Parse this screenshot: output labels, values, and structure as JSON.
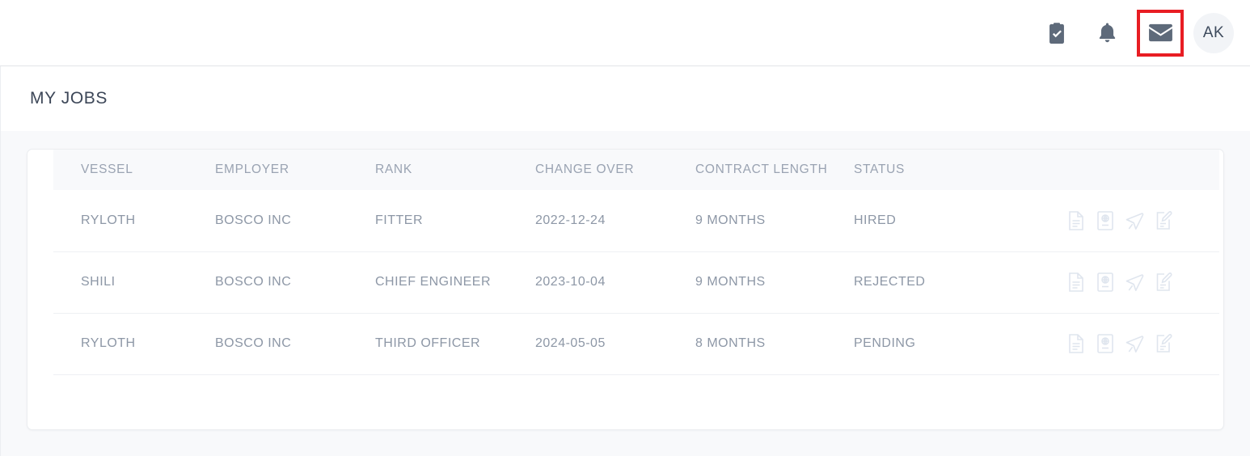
{
  "topbar": {
    "icons": [
      {
        "name": "clipboard-check-icon",
        "label": "Tasks"
      },
      {
        "name": "bell-icon",
        "label": "Notifications"
      },
      {
        "name": "mail-icon",
        "label": "Messages"
      }
    ],
    "mail_highlighted": true,
    "highlight_color": "#e81d23",
    "avatar_initials": "AK"
  },
  "page": {
    "title": "MY JOBS"
  },
  "table": {
    "columns": [
      "VESSEL",
      "EMPLOYER",
      "RANK",
      "CHANGE OVER",
      "CONTRACT LENGTH",
      "STATUS"
    ],
    "row_action_icons": [
      "document-icon",
      "passport-icon",
      "airplane-icon",
      "document-edit-icon"
    ],
    "rows": [
      {
        "vessel": "RYLOTH",
        "employer": "BOSCO INC",
        "rank": "FITTER",
        "change_over": "2022-12-24",
        "contract_length": "9 MONTHS",
        "status": "HIRED"
      },
      {
        "vessel": "SHILI",
        "employer": "BOSCO INC",
        "rank": "CHIEF ENGINEER",
        "change_over": "2023-10-04",
        "contract_length": "9 MONTHS",
        "status": "REJECTED"
      },
      {
        "vessel": "RYLOTH",
        "employer": "BOSCO INC",
        "rank": "THIRD OFFICER",
        "change_over": "2024-05-05",
        "contract_length": "8 MONTHS",
        "status": "PENDING"
      }
    ]
  }
}
